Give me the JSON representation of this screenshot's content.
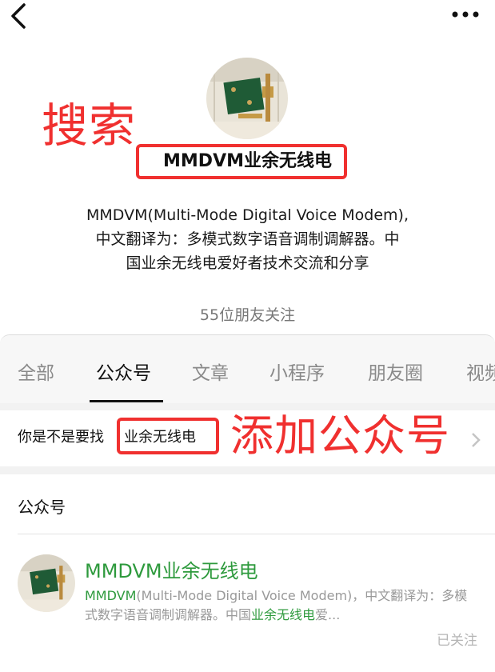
{
  "profile": {
    "name": "MMDVM业余无线电",
    "description_lines": [
      "MMDVM(Multi-Mode Digital Voice Modem),",
      "中文翻译为：多模式数字语音调制调解器。中",
      "国业余无线电爱好者技术交流和分享"
    ],
    "followers": "55位朋友关注"
  },
  "annotations": {
    "search": "搜索",
    "add": "添加公众号",
    "color": "#f0302f"
  },
  "tabs": [
    {
      "label": "全部",
      "active": false
    },
    {
      "label": "公众号",
      "active": true
    },
    {
      "label": "文章",
      "active": false
    },
    {
      "label": "小程序",
      "active": false
    },
    {
      "label": "朋友圈",
      "active": false
    },
    {
      "label": "视频",
      "active": false
    }
  ],
  "suggestion": {
    "prefix": "你是不是要找",
    "keyword": "业余无线电"
  },
  "results": {
    "section_title": "公众号",
    "items": [
      {
        "name": "MMDVM业余无线电",
        "desc_part1": "MMDVM",
        "desc_part2": "(Multi-Mode Digital Voice Modem)，中文翻译为：多模式数字语音调制调解器。中国",
        "desc_part3": "业余无线电",
        "desc_part4": "爱...",
        "status": "已关注"
      }
    ]
  },
  "icons": {
    "back": "back-arrow-icon",
    "more": "more-dots-icon",
    "chevron": "chevron-right-icon"
  },
  "colors": {
    "accent_green": "#2e9a3d",
    "annotation_red": "#f0302f",
    "sheet_bg": "#f2f2f2"
  }
}
